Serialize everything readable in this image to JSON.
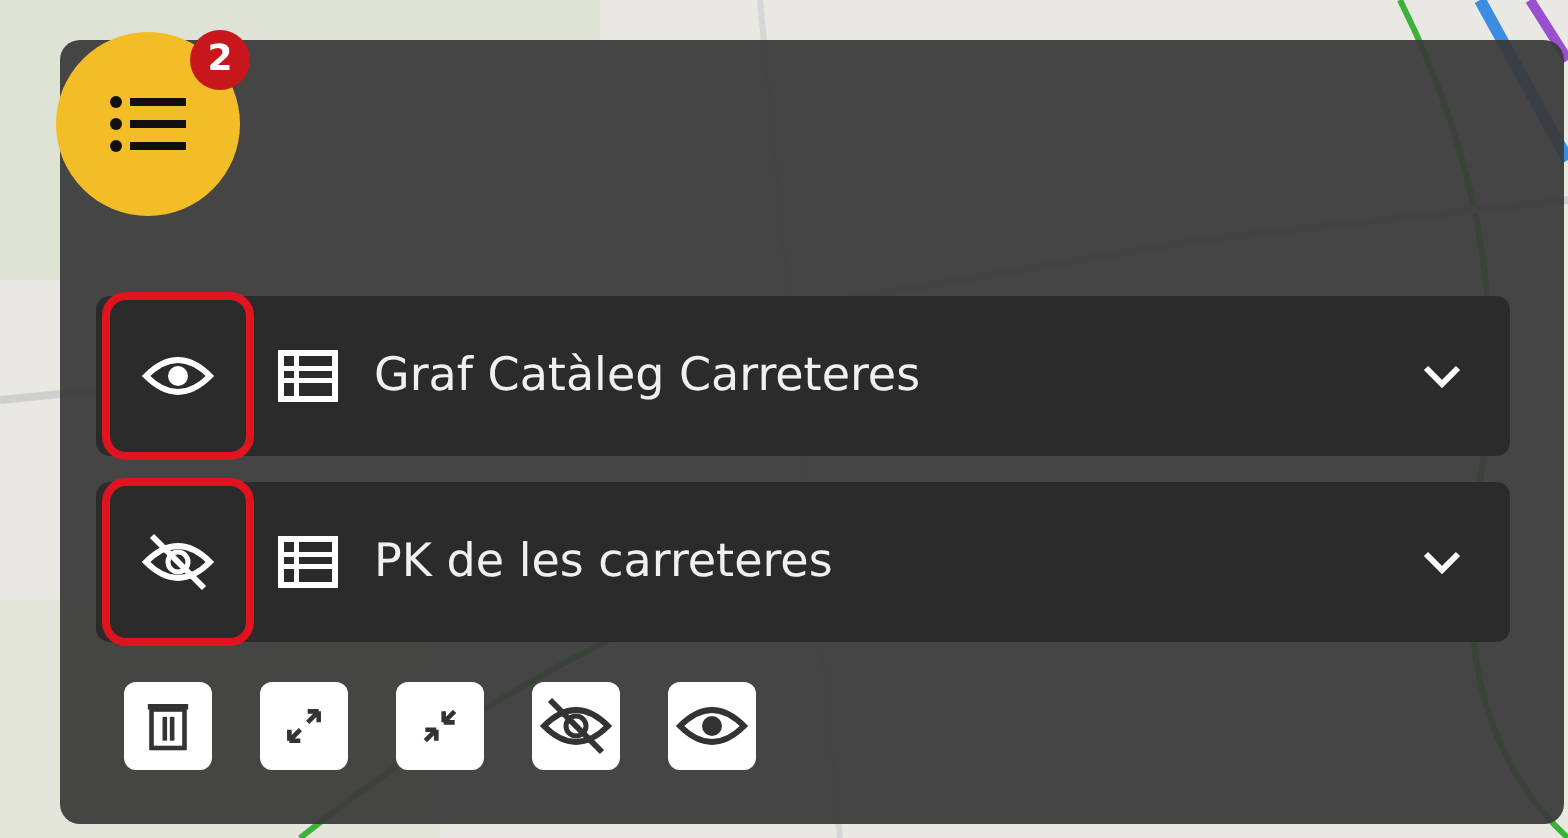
{
  "menu_button": {
    "badge": "2"
  },
  "layers": [
    {
      "name": "Graf Catàleg Carreteres",
      "visible": true,
      "highlighted": true
    },
    {
      "name": "PK de les carreteres",
      "visible": false,
      "highlighted": true
    }
  ],
  "toolbar": [
    {
      "kind": "delete"
    },
    {
      "kind": "expand"
    },
    {
      "kind": "collapse"
    },
    {
      "kind": "hide_all"
    },
    {
      "kind": "show_all"
    }
  ]
}
